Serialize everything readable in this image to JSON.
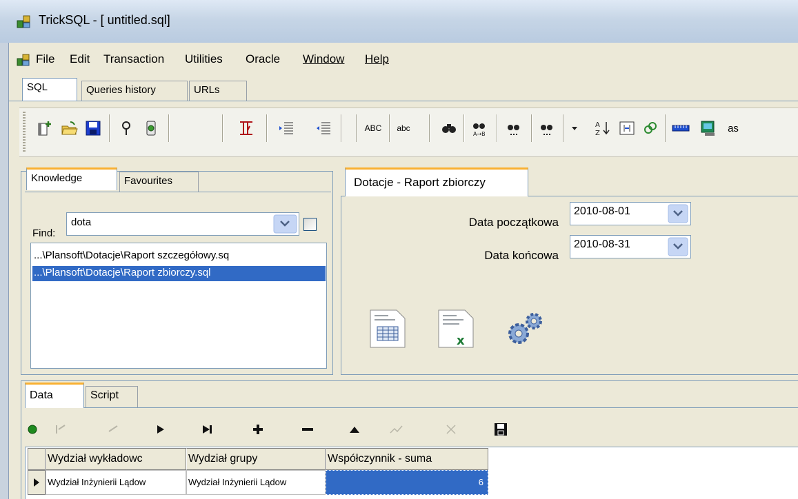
{
  "window": {
    "title": "TrickSQL - [ untitled.sql]"
  },
  "menu": {
    "items": [
      "File",
      "Edit",
      "Transaction",
      "Utilities",
      "Oracle",
      "Window",
      "Help"
    ]
  },
  "top_tabs": [
    {
      "label": "SQL",
      "active": true
    },
    {
      "label": "Queries history",
      "active": false
    },
    {
      "label": "URLs",
      "active": false
    }
  ],
  "toolbar": {
    "uppercase_label": "ABC",
    "lowercase_label": "abc",
    "as_label": "as"
  },
  "knowledge": {
    "tabs": [
      {
        "label": "Knowledge",
        "active": true
      },
      {
        "label": "Favourites",
        "active": false
      }
    ],
    "find_label": "Find:",
    "find_value": "dota",
    "files": [
      {
        "label": "...\\Plansoft\\Dotacje\\Raport szczegółowy.sq",
        "selected": false
      },
      {
        "label": "...\\Plansoft\\Dotacje\\Raport zbiorczy.sql",
        "selected": true
      }
    ]
  },
  "report": {
    "tab_label": "Dotacje - Raport zbiorczy",
    "start_label": "Data początkowa",
    "start_value": "2010-08-01",
    "end_label": "Data końcowa",
    "end_value": "2010-08-31"
  },
  "bottom": {
    "tabs": [
      {
        "label": "Data",
        "active": true
      },
      {
        "label": "Script",
        "active": false
      }
    ],
    "grid": {
      "columns": [
        "Wydział wykładowc",
        "Wydział grupy",
        "Współczynnik - suma"
      ],
      "rows": [
        [
          "Wydział Inżynierii Lądow",
          "Wydział Inżynierii Lądow",
          "6"
        ]
      ]
    }
  },
  "colors": {
    "selection": "#316ac5",
    "tab_accent": "#f9b031",
    "chrome": "#ece9d8"
  }
}
